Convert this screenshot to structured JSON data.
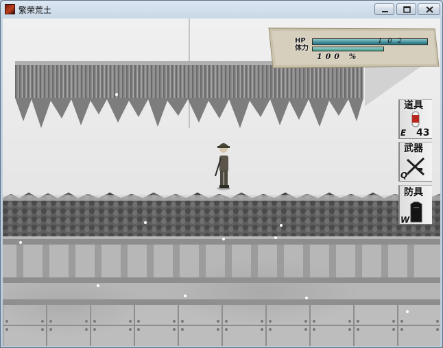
{
  "window": {
    "title": "繁荣荒土",
    "controls": [
      "minimize-button",
      "maximize-button",
      "close-button"
    ]
  },
  "hud": {
    "hp_label": "HP",
    "hp_value": "102",
    "hp_fraction": 1.0,
    "stamina_label": "体力",
    "stamina_value": "100 %",
    "stamina_fraction": 1.0
  },
  "equipment": {
    "item": {
      "title": "道具",
      "key": "E",
      "count": "43",
      "icon": "ration-capsule-icon"
    },
    "weapon": {
      "title": "武器",
      "key": "Q",
      "icon": "crossed-rifles-icon"
    },
    "armor": {
      "title": "防具",
      "key": "W",
      "icon": "body-armor-icon"
    }
  },
  "colors": {
    "hp_bar": "#3f8c98",
    "stamina_bar": "#3e9a8e",
    "snow_ground": "#e6e6e6"
  }
}
